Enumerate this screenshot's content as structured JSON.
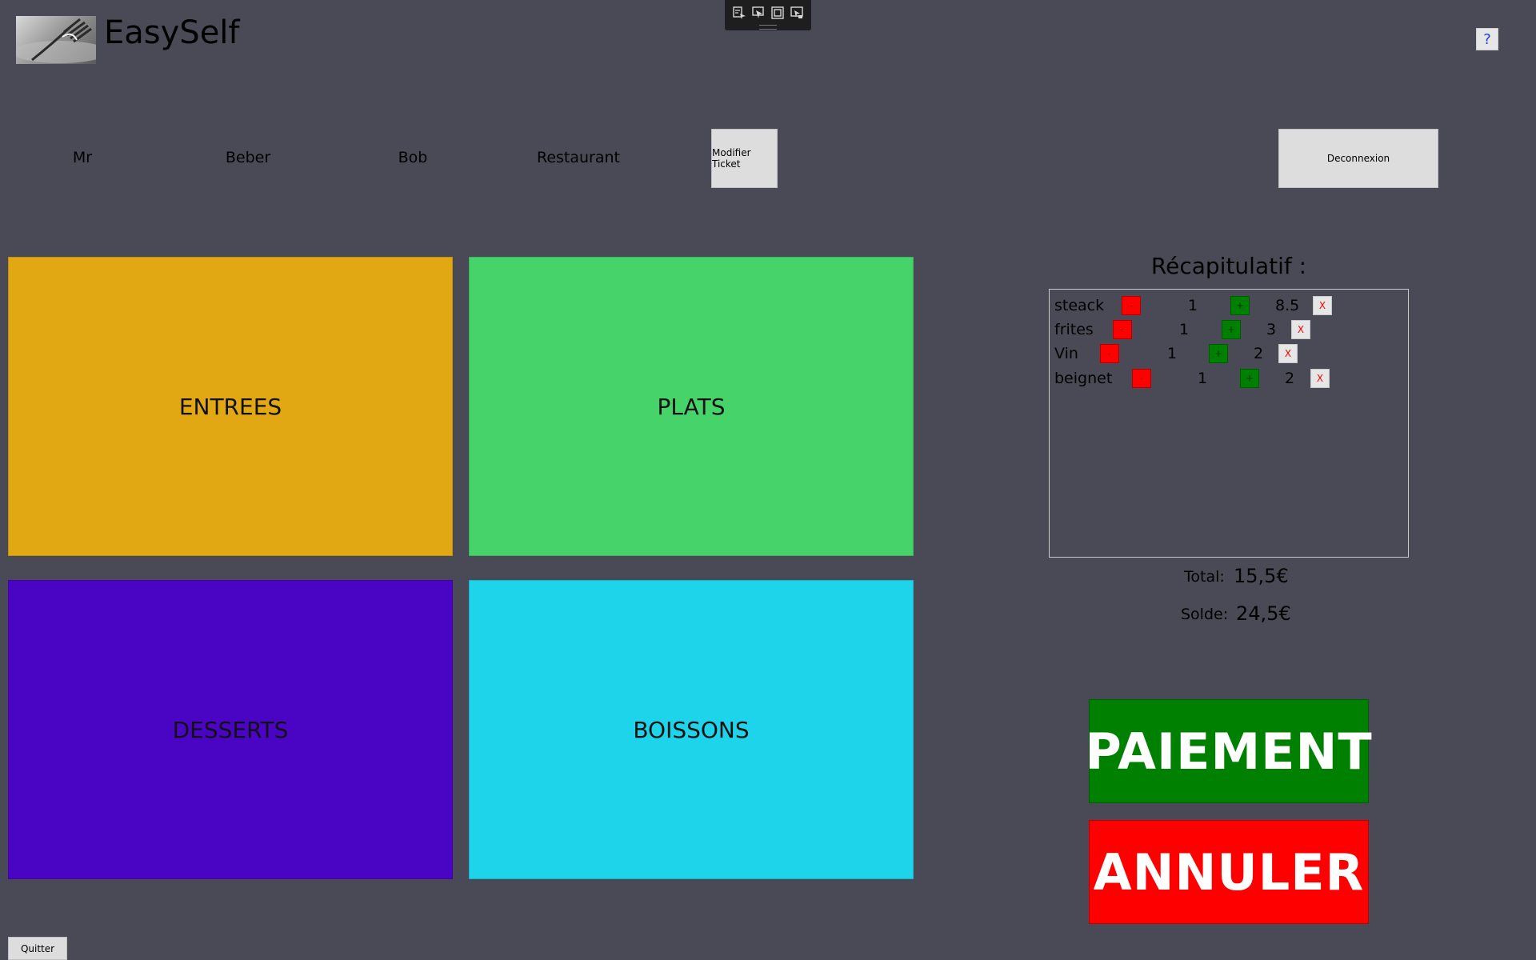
{
  "header": {
    "app_title": "EasySelf",
    "help_label": "?"
  },
  "user": {
    "title": "Mr",
    "first_name": "Beber",
    "last_name": "Bob",
    "place": "Restaurant"
  },
  "buttons": {
    "modify_ticket": "Modifier Ticket",
    "logout": "Deconnexion",
    "quit": "Quitter",
    "pay": "PAIEMENT",
    "cancel": "ANNULER"
  },
  "categories": {
    "entrees": "ENTREES",
    "plats": "PLATS",
    "desserts": "DESSERTS",
    "boissons": "BOISSONS"
  },
  "recap": {
    "title": "Récapitulatif :",
    "minus_label": "-",
    "plus_label": "+",
    "delete_label": "X",
    "items": [
      {
        "name": "steack",
        "qty": "1",
        "price": "8.5"
      },
      {
        "name": "frites",
        "qty": "1",
        "price": "3"
      },
      {
        "name": "Vin",
        "qty": "1",
        "price": "2"
      },
      {
        "name": "beignet",
        "qty": "1",
        "price": "2"
      }
    ]
  },
  "totals": {
    "total_label": "Total:",
    "total_value": "15,5€",
    "solde_label": "Solde:",
    "solde_value": "24,5€"
  },
  "colors": {
    "background": "#494a55",
    "entrees": "#e2a813",
    "plats": "#46d46a",
    "desserts": "#4a04c4",
    "boissons": "#1ed4ea",
    "pay": "#008000",
    "cancel": "#ff0000"
  },
  "debug_toolbar": {
    "icons": [
      "select-element-icon",
      "select-pointer-icon",
      "layout-adorner-icon",
      "track-focus-icon"
    ]
  }
}
